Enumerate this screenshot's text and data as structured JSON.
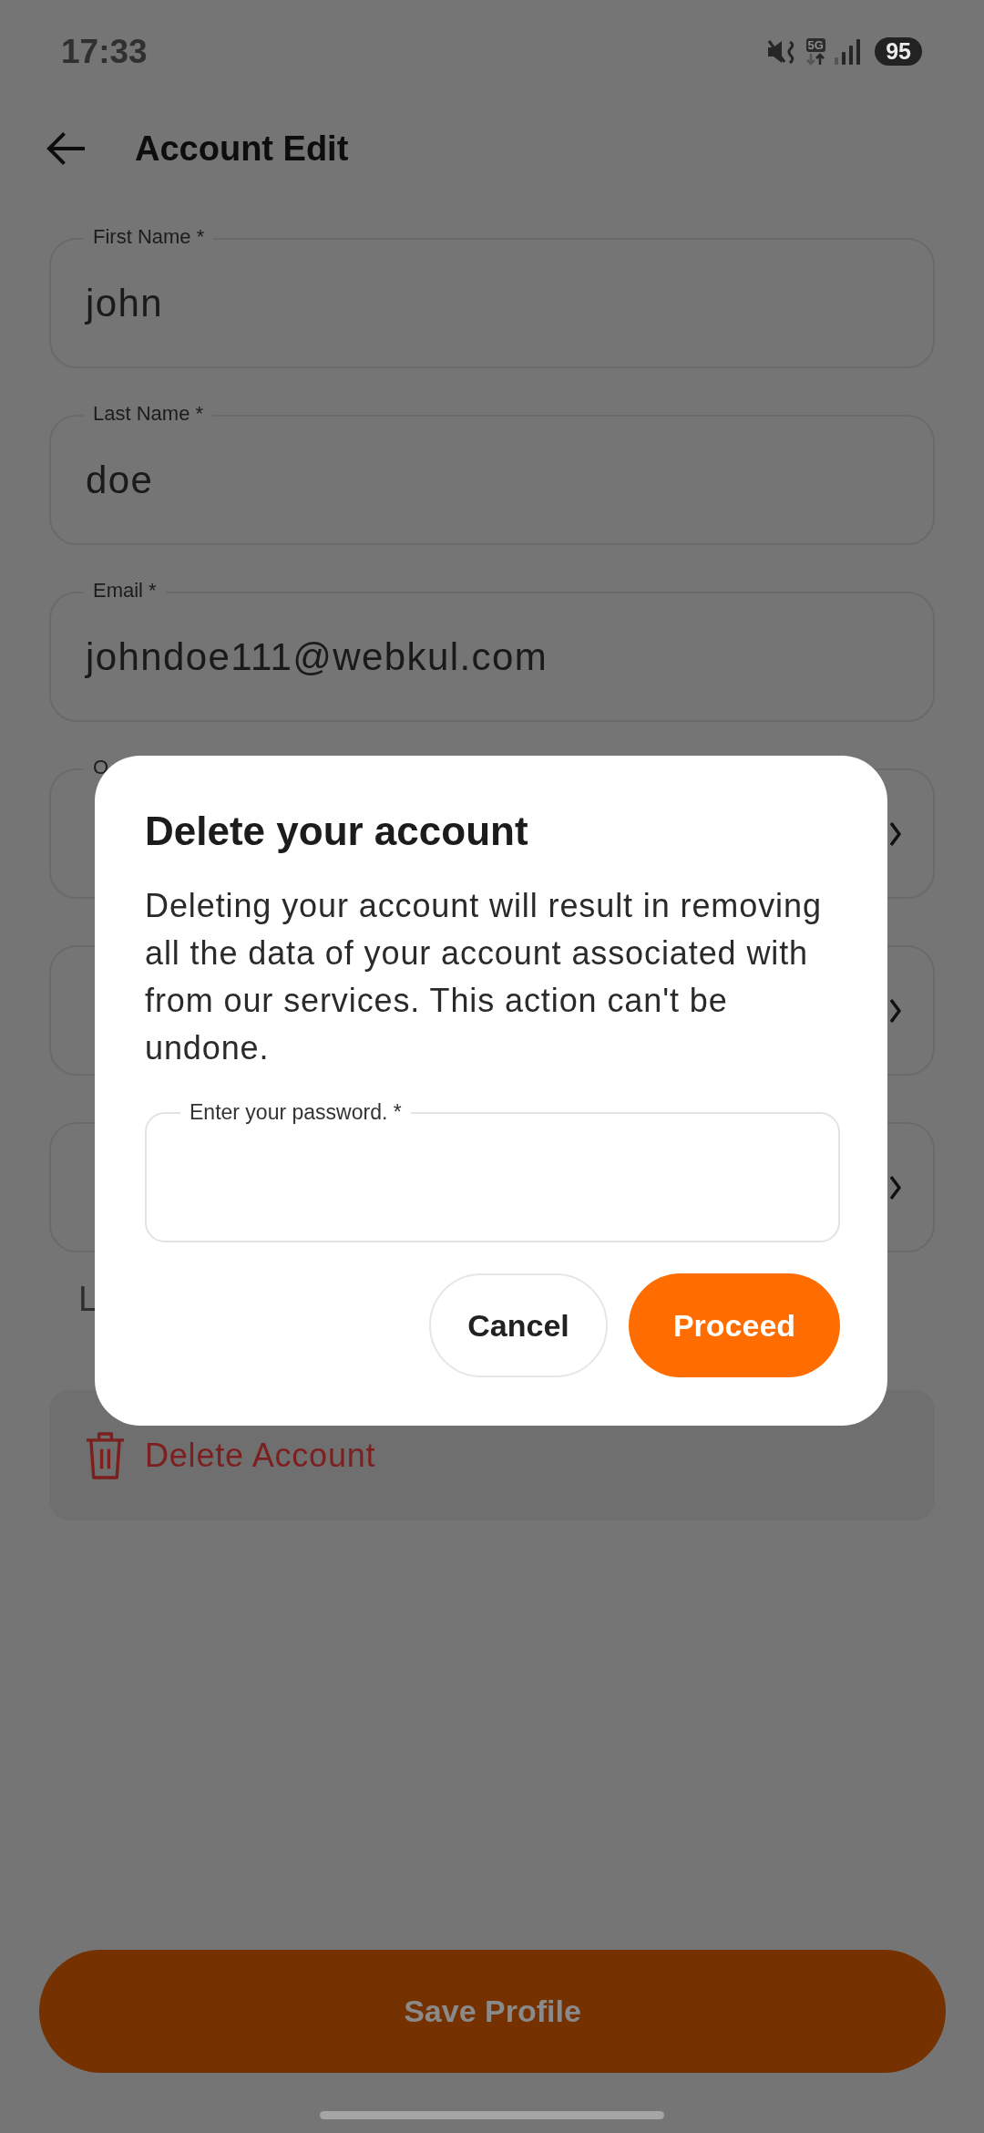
{
  "status_bar": {
    "time": "17:33",
    "network": "5G",
    "battery": "95"
  },
  "header": {
    "title": "Account Edit"
  },
  "form": {
    "fields": [
      {
        "kind": "text",
        "label": "First Name *",
        "value": "john"
      },
      {
        "kind": "text",
        "label": "Last Name *",
        "value": "doe"
      },
      {
        "kind": "text",
        "label": "Email *",
        "value": "johndoe111@webkul.com"
      },
      {
        "kind": "dropdown",
        "label": "O"
      },
      {
        "kind": "dropdown"
      },
      {
        "kind": "dropdown"
      }
    ],
    "line_below_fields": "L"
  },
  "delete_account": {
    "label": "Delete Account"
  },
  "save_button": {
    "label": "Save Profile"
  },
  "dialog": {
    "title": "Delete your account",
    "message": "Deleting your account will result in removing all the data of your account associated with from our services. This action can't be undone.",
    "password_field": {
      "label": "Enter your password. *"
    },
    "buttons": [
      {
        "kind": "outlined",
        "label": "Cancel"
      },
      {
        "kind": "filled",
        "label": "Proceed"
      }
    ]
  }
}
